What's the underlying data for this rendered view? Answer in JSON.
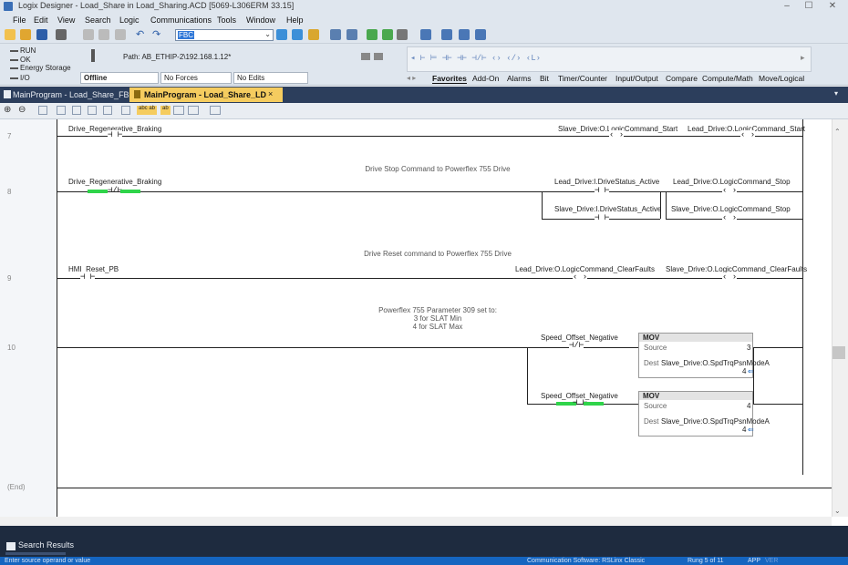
{
  "window": {
    "title": "Logix Designer - Load_Share in Load_Sharing.ACD [5069-L306ERM 33.15]"
  },
  "menu": [
    "File",
    "Edit",
    "View",
    "Search",
    "Logic",
    "Communications",
    "Tools",
    "Window",
    "Help"
  ],
  "toolbar": {
    "search_value": "FBC"
  },
  "status": {
    "run": "RUN",
    "ok": "OK",
    "energy": "Energy Storage",
    "io": "I/O",
    "path_label": "Path:",
    "path_value": "AB_ETHIP-2\\192.168.1.12*",
    "mode": "Offline",
    "forces": "No Forces",
    "edits": "No Edits"
  },
  "instruction_tabs": [
    "Favorites",
    "Add-On",
    "Alarms",
    "Bit",
    "Timer/Counter",
    "Input/Output",
    "Compare",
    "Compute/Math",
    "Move/Logical"
  ],
  "doc_tabs": [
    {
      "label": "MainProgram - Load_Share_FB",
      "active": false
    },
    {
      "label": "MainProgram - Load_Share_LD",
      "active": true
    }
  ],
  "doc_tab_close": "×",
  "toolbar2": {
    "badge_a": "abc ab",
    "badge_b": "ab"
  },
  "rungs": [
    {
      "number": "7",
      "contact": "Drive_Regenerative_Braking",
      "coil1": "Slave_Drive:O.LogicCommand_Start",
      "coil2": "Lead_Drive:O.LogicCommand_Start"
    },
    {
      "number": "8",
      "comment": "Drive Stop Command to Powerflex 755 Drive",
      "contact": "Drive_Regenerative_Braking",
      "branch_contact1": "Lead_Drive:I.DriveStatus_Active",
      "branch_contact2": "Slave_Drive:I.DriveStatus_Active",
      "coil": "Lead_Drive:O.LogicCommand_Stop",
      "coil2": "Slave_Drive:O.LogicCommand_Stop"
    },
    {
      "number": "9",
      "comment": "Drive Reset command to Powerflex 755 Drive",
      "contact": "HMI_Reset_PB",
      "coil1": "Lead_Drive:O.LogicCommand_ClearFaults",
      "coil2": "Slave_Drive:O.LogicCommand_ClearFaults"
    },
    {
      "number": "10",
      "comment_lines": [
        "Powerflex 755 Parameter 309 set to:",
        "3 for SLAT Min",
        "4 for SLAT Max"
      ],
      "contact1": "Speed_Offset_Negative",
      "contact2": "Speed_Offset_Negative",
      "mov1": {
        "name": "MOV",
        "source_label": "Source",
        "source": "3",
        "dest_label": "Dest",
        "dest": "Slave_Drive:O.SpdTrqPsnModeA",
        "dest_value": "4"
      },
      "mov2": {
        "name": "MOV",
        "source_label": "Source",
        "source": "4",
        "dest_label": "Dest",
        "dest": "Slave_Drive:O.SpdTrqPsnModeA",
        "dest_value": "4"
      }
    },
    {
      "number": "(End)"
    }
  ],
  "search_results": {
    "label": "Search Results"
  },
  "bottom_status": {
    "left": "Enter source operand or value",
    "comm": "Communication Software: RSLinx Classic",
    "rung": "Rung 5 of 11",
    "app": "APP",
    "ver": "VER"
  },
  "colors": {
    "accent": "#1565c0",
    "tab_active": "#f5cc5f",
    "navy": "#2c3e5c",
    "energized": "#2fd44a"
  },
  "icons": [
    "new-icon",
    "open-icon",
    "save-icon",
    "print-icon",
    "cut-icon",
    "copy-icon",
    "paste-icon",
    "undo-icon",
    "redo-icon",
    "minimize-icon",
    "maximize-icon",
    "close-icon",
    "zoom-in-icon",
    "zoom-out-icon",
    "search-results-icon"
  ]
}
